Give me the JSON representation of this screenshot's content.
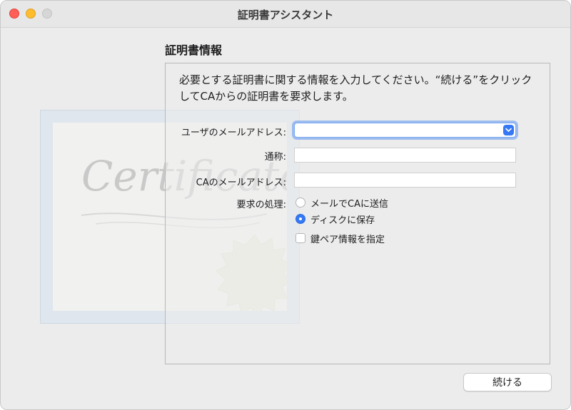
{
  "window": {
    "title": "証明書アシスタント"
  },
  "illustration": {
    "script_text": "Certificate"
  },
  "section": {
    "title": "証明書情報",
    "intro": "必要とする証明書に関する情報を入力してください。“続ける”をクリックしてCAからの証明書を要求します。"
  },
  "form": {
    "email": {
      "label": "ユーザのメールアドレス:",
      "value": ""
    },
    "common_name": {
      "label": "通称:",
      "value": ""
    },
    "ca_email": {
      "label": "CAのメールアドレス:",
      "value": ""
    },
    "request": {
      "label": "要求の処理:",
      "options": [
        {
          "label": "メールでCAに送信",
          "selected": false
        },
        {
          "label": "ディスクに保存",
          "selected": true
        }
      ]
    },
    "keypair": {
      "label": "鍵ペア情報を指定",
      "checked": false
    }
  },
  "buttons": {
    "continue": "続ける"
  },
  "colors": {
    "accent": "#3478f6",
    "close": "#ff5f57",
    "minimize": "#febc2e",
    "zoom_disabled": "#d6d6d6"
  }
}
